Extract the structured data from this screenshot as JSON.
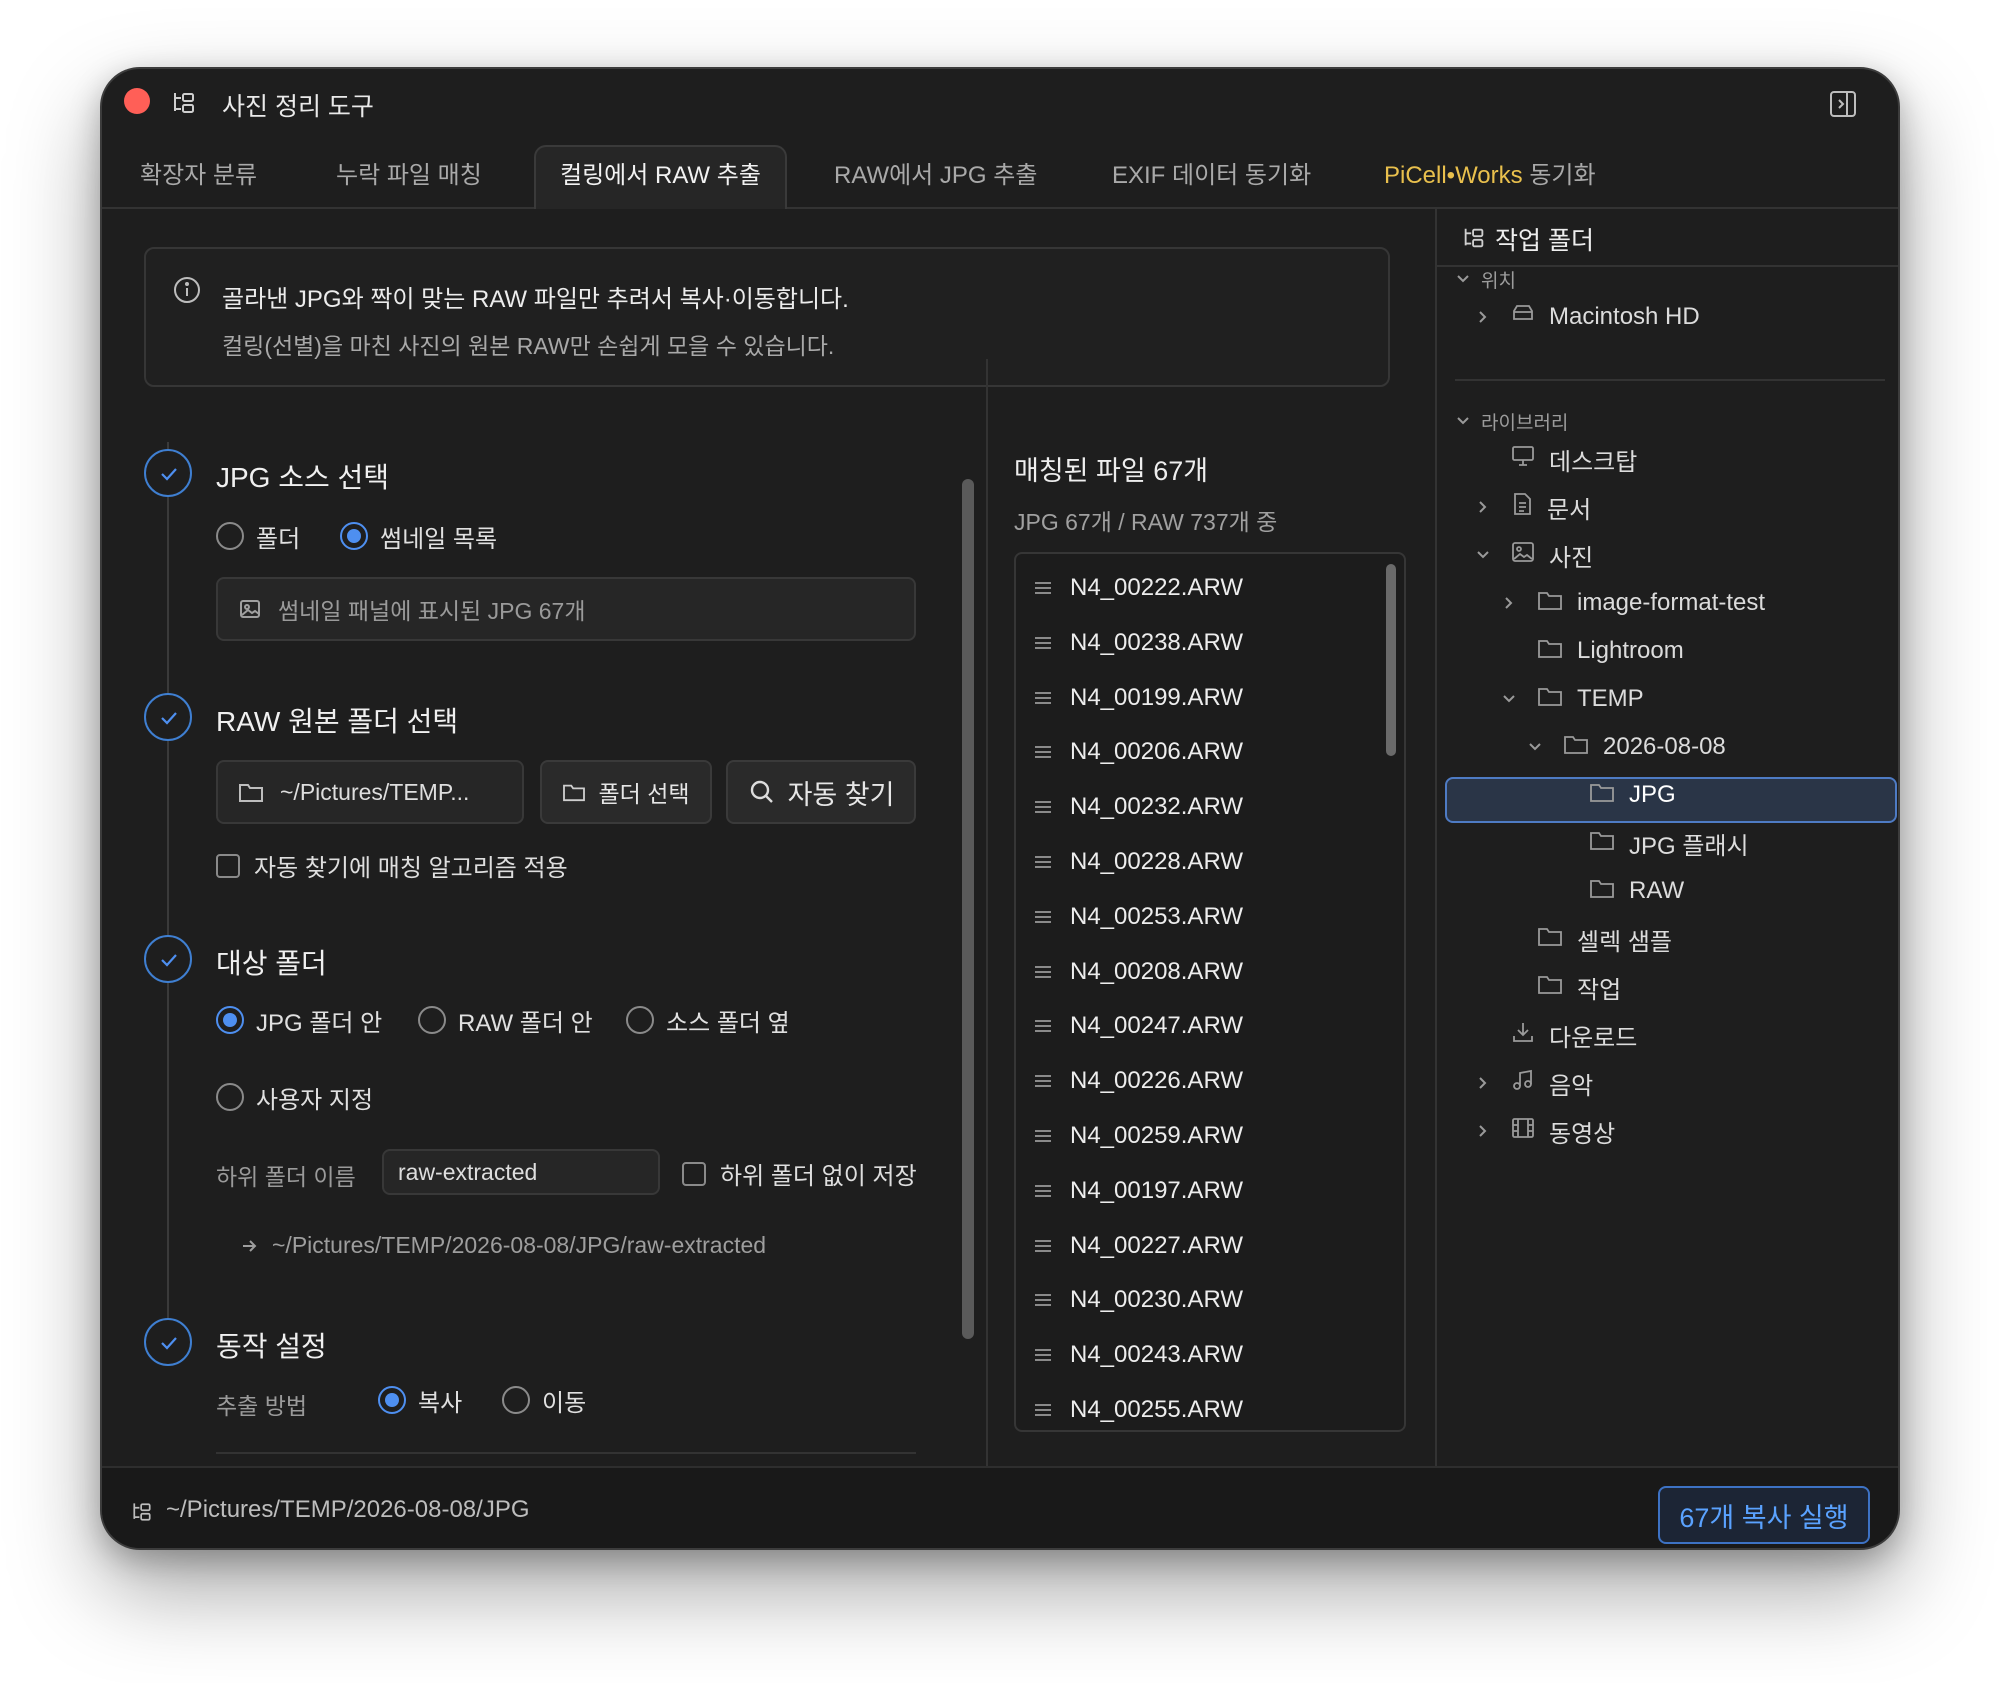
{
  "window": {
    "title": "사진 정리 도구"
  },
  "tabs": [
    {
      "label": "확장자 분류"
    },
    {
      "label": "누락 파일 매칭"
    },
    {
      "label": "컬링에서 RAW 추출",
      "active": true
    },
    {
      "label": "RAW에서 JPG 추출"
    },
    {
      "label": "EXIF 데이터 동기화"
    },
    {
      "label_brand": "PiCell•Works",
      "label_rest": " 동기화",
      "brand_color": "#e9c04d"
    }
  ],
  "info": {
    "line1": "골라낸 JPG와 짝이 맞는 RAW 파일만 추려서 복사·이동합니다.",
    "line2": "컬링(선별)을 마친 사진의 원본 RAW만 손쉽게 모을 수 있습니다."
  },
  "steps": {
    "jpg_source": {
      "title": "JPG 소스 선택",
      "options": [
        "폴더",
        "썸네일 목록"
      ],
      "selected": "썸네일 목록",
      "thumbnail_info": "썸네일 패널에 표시된 JPG 67개"
    },
    "raw_folder": {
      "title": "RAW 원본 폴더 선택",
      "path": "~/Pictures/TEMP...",
      "select_button": "폴더 선택",
      "auto_button": "자동 찾기",
      "algorithm_checkbox": "자동 찾기에 매칭 알고리즘 적용",
      "algorithm_checked": false
    },
    "target_folder": {
      "title": "대상 폴더",
      "options": [
        "JPG 폴더 안",
        "RAW 폴더 안",
        "소스 폴더 옆",
        "사용자 지정"
      ],
      "selected": "JPG 폴더 안",
      "subfolder_label": "하위 폴더 이름",
      "subfolder_value": "raw-extracted",
      "no_subfolder_checkbox": "하위 폴더 없이 저장",
      "no_subfolder_checked": false,
      "preview_path": "~/Pictures/TEMP/2026-08-08/JPG/raw-extracted"
    },
    "action": {
      "title": "동작 설정",
      "method_label": "추출 방법",
      "options": [
        "복사",
        "이동"
      ],
      "selected": "복사"
    }
  },
  "matched": {
    "title": "매칭된 파일 67개",
    "subtitle": "JPG 67개 / RAW 737개 중",
    "files": [
      "N4_00222.ARW",
      "N4_00238.ARW",
      "N4_00199.ARW",
      "N4_00206.ARW",
      "N4_00232.ARW",
      "N4_00228.ARW",
      "N4_00253.ARW",
      "N4_00208.ARW",
      "N4_00247.ARW",
      "N4_00226.ARW",
      "N4_00259.ARW",
      "N4_00197.ARW",
      "N4_00227.ARW",
      "N4_00230.ARW",
      "N4_00243.ARW",
      "N4_00255.ARW"
    ]
  },
  "work_folder": {
    "title": "작업 폴더",
    "location_label": "위치",
    "location_items": [
      "Macintosh HD"
    ],
    "library_label": "라이브러리",
    "tree": [
      "데스크탑",
      "문서",
      "사진",
      "image-format-test",
      "Lightroom",
      "TEMP",
      "2026-08-08",
      "JPG",
      "JPG 플래시",
      "RAW",
      "셀렉 샘플",
      "작업",
      "다운로드",
      "음악",
      "동영상"
    ],
    "selected": "JPG"
  },
  "footer": {
    "path": "~/Pictures/TEMP/2026-08-08/JPG",
    "run_button": "67개 복사 실행"
  },
  "colors": {
    "accent": "#4e8ff0",
    "selection": "#2a3547",
    "background": "#1e1e1e"
  }
}
